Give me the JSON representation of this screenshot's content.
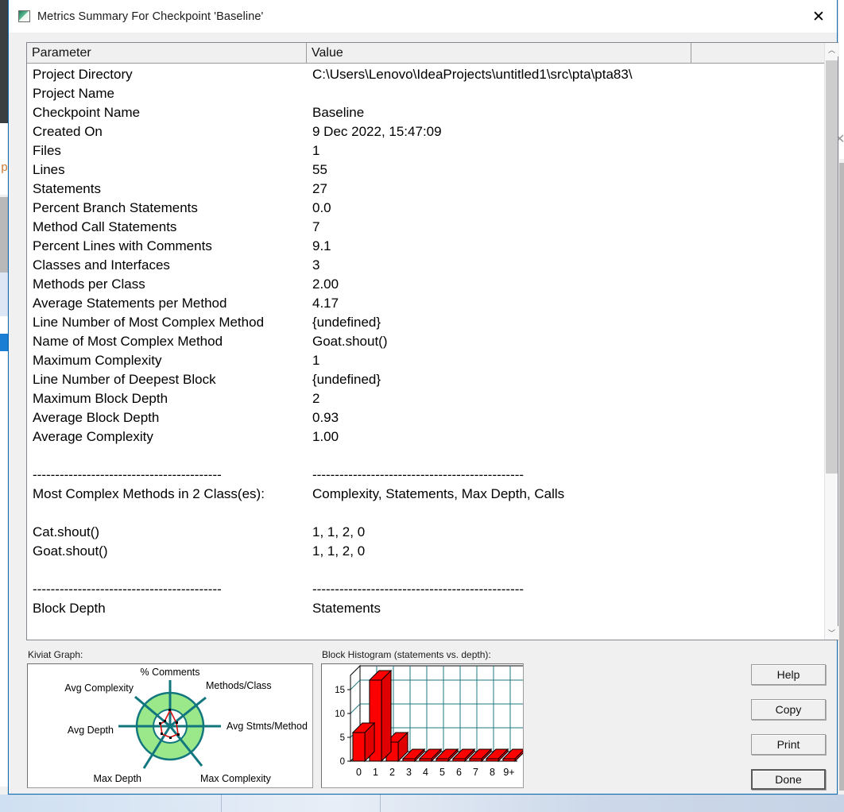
{
  "window": {
    "title": "Metrics Summary For Checkpoint 'Baseline'",
    "icon": "metrics-app-icon",
    "close_icon": "✕"
  },
  "table": {
    "headers": [
      "Parameter",
      "Value",
      ""
    ],
    "rows": [
      {
        "parameter": "Project Directory",
        "value": "C:\\Users\\Lenovo\\IdeaProjects\\untitled1\\src\\pta\\pta83\\"
      },
      {
        "parameter": "Project Name",
        "value": ""
      },
      {
        "parameter": "Checkpoint Name",
        "value": "Baseline"
      },
      {
        "parameter": "Created On",
        "value": "9 Dec 2022, 15:47:09"
      },
      {
        "parameter": "Files",
        "value": "1"
      },
      {
        "parameter": "Lines",
        "value": "55"
      },
      {
        "parameter": "Statements",
        "value": "27"
      },
      {
        "parameter": "Percent Branch Statements",
        "value": "0.0"
      },
      {
        "parameter": "Method Call Statements",
        "value": "7"
      },
      {
        "parameter": "Percent Lines with Comments",
        "value": "9.1"
      },
      {
        "parameter": "Classes and Interfaces",
        "value": "3"
      },
      {
        "parameter": "Methods per Class",
        "value": "2.00"
      },
      {
        "parameter": "Average Statements per Method",
        "value": "4.17"
      },
      {
        "parameter": "Line Number of Most Complex Method",
        "value": "{undefined}"
      },
      {
        "parameter": "Name of Most Complex Method",
        "value": "Goat.shout()"
      },
      {
        "parameter": "Maximum Complexity",
        "value": "1"
      },
      {
        "parameter": "Line Number of Deepest Block",
        "value": "{undefined}"
      },
      {
        "parameter": "Maximum Block Depth",
        "value": "2"
      },
      {
        "parameter": "Average Block Depth",
        "value": "0.93"
      },
      {
        "parameter": "Average Complexity",
        "value": "1.00"
      },
      {
        "parameter": "",
        "value": ""
      },
      {
        "parameter": "------------------------------------------",
        "value": "-----------------------------------------------"
      },
      {
        "parameter": "Most Complex Methods in 2 Class(es):",
        "value": "Complexity, Statements, Max Depth, Calls"
      },
      {
        "parameter": "",
        "value": ""
      },
      {
        "parameter": "Cat.shout()",
        "value": "1, 1, 2, 0"
      },
      {
        "parameter": "Goat.shout()",
        "value": "1, 1, 2, 0"
      },
      {
        "parameter": "",
        "value": ""
      },
      {
        "parameter": "------------------------------------------",
        "value": "-----------------------------------------------"
      },
      {
        "parameter": "Block Depth",
        "value": "Statements"
      }
    ]
  },
  "scrollbar": {
    "up_arrow": "︿",
    "down_arrow": "﹀"
  },
  "kiviat": {
    "label": "Kiviat Graph:",
    "axes": [
      "% Comments",
      "Methods/Class",
      "Avg Stmts/Method",
      "Max Complexity",
      "Max Depth",
      "Avg Depth",
      "Avg Complexity"
    ],
    "band_color": "#9BE88A",
    "axis_color": "#12767E",
    "series_color": "#D81010"
  },
  "histogram": {
    "label": "Block Histogram (statements vs. depth):"
  },
  "chart_data": {
    "type": "bar",
    "title": "Block Histogram (statements vs. depth)",
    "xlabel": "",
    "ylabel": "",
    "categories": [
      "0",
      "1",
      "2",
      "3",
      "4",
      "5",
      "6",
      "7",
      "8",
      "9+"
    ],
    "values": [
      6,
      17,
      4,
      0,
      0,
      0,
      0,
      0,
      0,
      0
    ],
    "yticks": [
      0,
      5,
      10,
      15
    ],
    "ylim": [
      0,
      18
    ],
    "grid": true,
    "legend": "none",
    "bar_color": "#FF0000",
    "grid_color": "#1F7A80"
  },
  "buttons": [
    {
      "label": "Help",
      "name": "help-button",
      "focused": false
    },
    {
      "label": "Copy",
      "name": "copy-button",
      "focused": false
    },
    {
      "label": "Print",
      "name": "print-button",
      "focused": false
    },
    {
      "label": "Done",
      "name": "done-button",
      "focused": true
    }
  ]
}
